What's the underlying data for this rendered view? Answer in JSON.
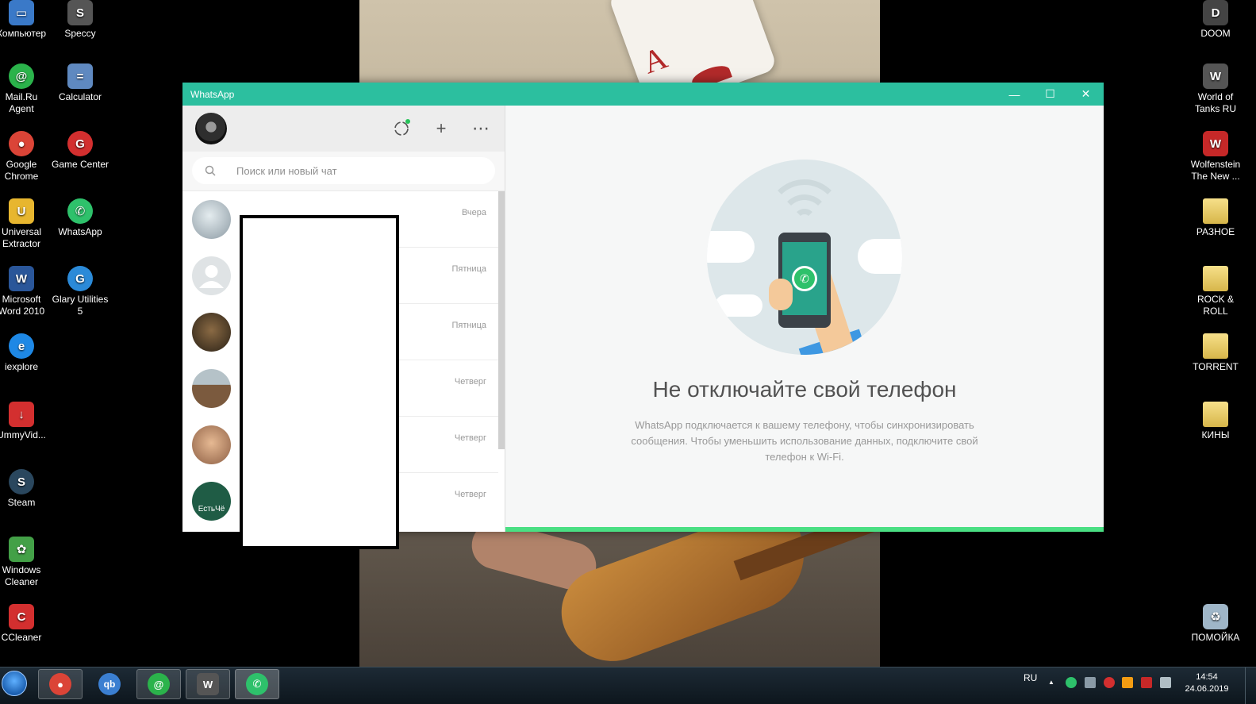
{
  "desktop": {
    "left_icons": [
      {
        "label": "Компьютер",
        "icon": "computer-icon",
        "color": "#3a79c8"
      },
      {
        "label": "Speccy",
        "icon": "speccy-icon",
        "color": "#555555"
      },
      {
        "label": "Mail.Ru Agent",
        "icon": "mailru-agent-icon",
        "color": "#2bb34b"
      },
      {
        "label": "Calculator",
        "icon": "calculator-icon",
        "color": "#5f89c0"
      },
      {
        "label": "Google Chrome",
        "icon": "chrome-icon",
        "color": "#db4437"
      },
      {
        "label": "Game Center",
        "icon": "game-center-icon",
        "color": "#d32f2f"
      },
      {
        "label": "Universal Extractor",
        "icon": "universal-extractor-icon",
        "color": "#e7b62f"
      },
      {
        "label": "WhatsApp",
        "icon": "whatsapp-icon",
        "color": "#2ec16b"
      },
      {
        "label": "Microsoft Word 2010",
        "icon": "word-icon",
        "color": "#2a5699"
      },
      {
        "label": "Glary Utilities 5",
        "icon": "glary-utilities-icon",
        "color": "#2b8ad8"
      },
      {
        "label": "iexplore",
        "icon": "internet-explorer-icon",
        "color": "#1e88e5"
      },
      {
        "label": "UmmyVid...",
        "icon": "ummy-video-icon",
        "color": "#d32f2f"
      },
      {
        "label": "Steam",
        "icon": "steam-icon",
        "color": "#2a475e"
      },
      {
        "label": "Windows Cleaner",
        "icon": "windows-cleaner-icon",
        "color": "#43a047"
      },
      {
        "label": "CCleaner",
        "icon": "ccleaner-icon",
        "color": "#d32f2f"
      }
    ],
    "right_icons": [
      {
        "label": "DOOM",
        "icon": "doom-icon",
        "color": "#444444"
      },
      {
        "label": "World of Tanks RU",
        "icon": "world-of-tanks-icon",
        "color": "#555555"
      },
      {
        "label": "Wolfenstein The New ...",
        "icon": "wolfenstein-icon",
        "color": "#c62828"
      },
      {
        "label": "РАЗНОЕ",
        "icon": "folder-icon",
        "color": "#e8c95a"
      },
      {
        "label": "ROCK & ROLL",
        "icon": "folder-icon",
        "color": "#e8c95a"
      },
      {
        "label": "TORRENT",
        "icon": "folder-icon",
        "color": "#e8c95a"
      },
      {
        "label": "КИНЫ",
        "icon": "folder-icon",
        "color": "#e8c95a"
      },
      {
        "label": "ПОМОЙКА",
        "icon": "recycle-bin-icon",
        "color": "#9fb6c8"
      }
    ],
    "glyphs": {
      "speccy": "S",
      "mailru": "@",
      "calculator": "=",
      "chrome": "●",
      "game_center": "G",
      "extractor": "U",
      "whatsapp": "✆",
      "word": "W",
      "glary": "G",
      "ie": "e",
      "ummy": "↓",
      "steam": "S",
      "cleaner": "✿",
      "ccleaner": "C",
      "doom": "D",
      "wot": "W",
      "wolf": "W",
      "bin": "♻",
      "computer": "▭"
    }
  },
  "wallpaper": {
    "card_letter": "A"
  },
  "window": {
    "title": "WhatsApp",
    "accent": "#2cbf9f",
    "controls": {
      "minimize": "—",
      "maximize": "☐",
      "close": "✕"
    }
  },
  "sidebar": {
    "icons": {
      "status": "status-icon",
      "new_chat": "new-chat-icon",
      "menu": "menu-icon"
    },
    "header_glyphs": {
      "new_chat": "+",
      "menu": "⋯"
    },
    "search": {
      "placeholder": "Поиск или новый чат",
      "icon": "search-icon"
    },
    "chats": [
      {
        "time": "Вчера",
        "avatar": "#b9c3c9"
      },
      {
        "time": "Пятница",
        "avatar": "#dfe3e5"
      },
      {
        "time": "Пятница",
        "avatar": "#6d5233"
      },
      {
        "time": "Четверг",
        "avatar": "#8b6c4f"
      },
      {
        "time": "Четверг",
        "avatar": "#c79a78"
      },
      {
        "time": "Четверг",
        "avatar": "#1f5c45",
        "avatar_text": "ЕстьЧё"
      }
    ]
  },
  "main": {
    "title": "Не отключайте свой телефон",
    "description": "WhatsApp подключается к вашему телефону, чтобы синхронизировать сообщения. Чтобы уменьшить использование данных, подключите свой телефон к Wi-Fi."
  },
  "taskbar": {
    "apps": [
      {
        "name": "taskbar-chrome",
        "glyph": "●",
        "color": "#db4437",
        "active": true
      },
      {
        "name": "taskbar-qbittorrent",
        "glyph": "qb",
        "color": "#3b7fd1",
        "active": false
      },
      {
        "name": "taskbar-mailru-agent",
        "glyph": "@",
        "color": "#2bb34b",
        "active": true
      },
      {
        "name": "taskbar-world-of-tanks",
        "glyph": "W",
        "color": "#555555",
        "active": true
      },
      {
        "name": "taskbar-whatsapp",
        "glyph": "✆",
        "color": "#2ec16b",
        "active": true
      }
    ],
    "language": "RU",
    "tray_arrow": "▲",
    "clock_time": "14:54",
    "clock_date": "24.06.2019"
  }
}
